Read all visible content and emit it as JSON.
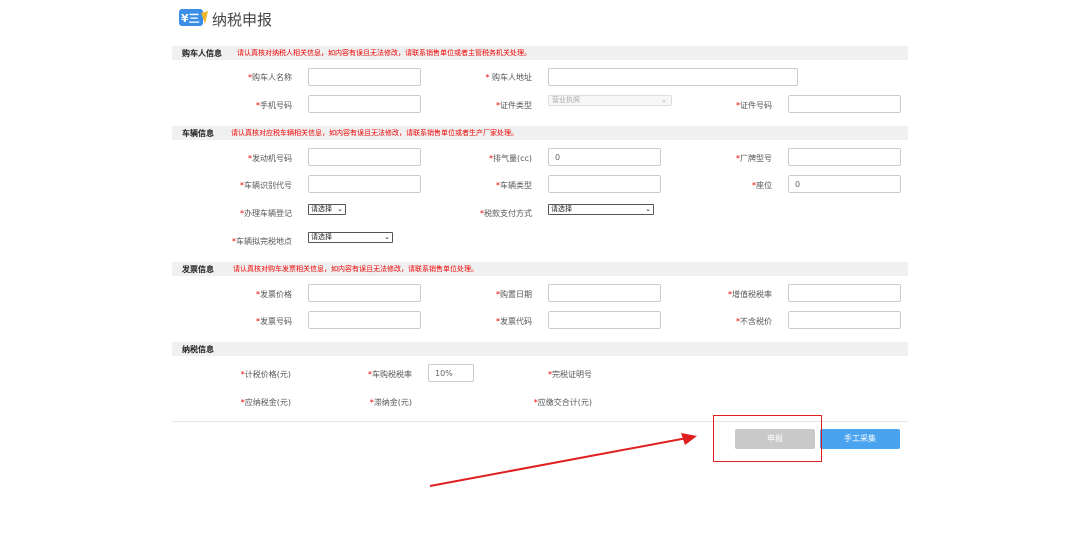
{
  "page": {
    "title": "纳税申报",
    "logo_text": "¥三"
  },
  "buyer": {
    "section_title": "购车人信息",
    "notice": "请认真核对纳税人相关信息，如内容有误且无法修改，请联系销售单位或者主管税务机关处理。",
    "name_label": "购车人名称",
    "address_label": "购车人地址",
    "phone_label": "手机号码",
    "id_type_label": "证件类型",
    "id_type_value": "营业执照",
    "id_number_label": "证件号码"
  },
  "vehicle": {
    "section_title": "车辆信息",
    "notice": "请认真核对应税车辆相关信息，如内容有误且无法修改，请联系销售单位或者生产厂家处理。",
    "engine_label": "发动机号码",
    "displacement_label": "排气量(cc)",
    "displacement_value": "0",
    "model_label": "厂牌型号",
    "vin_label": "车辆识别代号",
    "type_label": "车辆类型",
    "seats_label": "座位",
    "seats_value": "0",
    "registration_label": "办理车辆登记",
    "registration_value": "请选择",
    "payment_label": "税款支付方式",
    "payment_value": "请选择",
    "location_label": "车辆拟完税地点",
    "location_value": "请选择"
  },
  "invoice": {
    "section_title": "发票信息",
    "notice": "请认真核对购车发票相关信息，如内容有误且无法修改，请联系销售单位处理。",
    "price_label": "发票价格",
    "date_label": "购置日期",
    "vat_rate_label": "增值税税率",
    "number_label": "发票号码",
    "code_label": "发票代码",
    "tax_excluded_label": "不含税价"
  },
  "tax": {
    "section_title": "纳税信息",
    "taxable_price_label": "计税价格(元)",
    "rate_label": "车购税税率",
    "rate_value": "10%",
    "certificate_label": "完税证明号",
    "payable_label": "应纳税金(元)",
    "late_fee_label": "滞纳金(元)",
    "total_label": "应缴交合计(元)"
  },
  "actions": {
    "submit_label": "申报",
    "manual_label": "手工采集"
  },
  "colors": {
    "required": "#e00000",
    "primary": "#4aa3ee",
    "disabled": "#c9c9c9",
    "annotation": "#e02020"
  }
}
